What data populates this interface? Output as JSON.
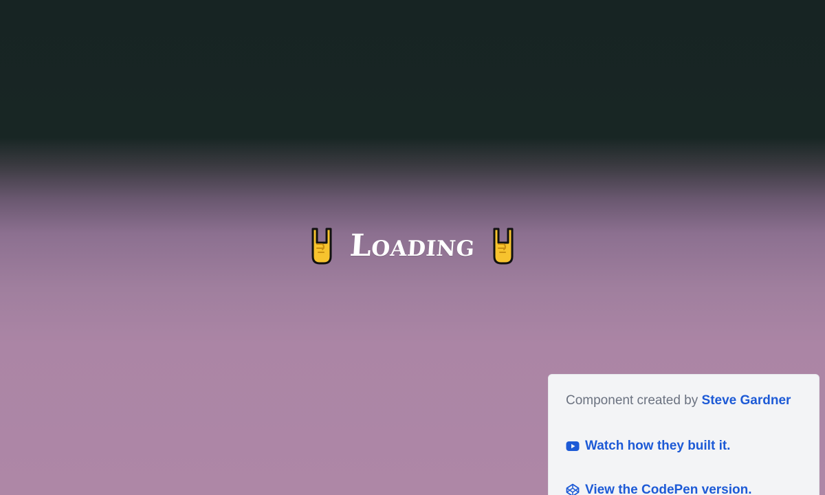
{
  "loader": {
    "text": "Loading",
    "left_icon": "sign-of-the-horns-icon",
    "right_icon": "sign-of-the-horns-icon"
  },
  "credit": {
    "prefix": "Component created by",
    "author": "Steve Gardner",
    "watch_link": {
      "label": "Watch how they built it.",
      "icon": "youtube-icon"
    },
    "codepen_link": {
      "label": "View the CodePen version.",
      "icon": "codepen-icon"
    }
  },
  "colors": {
    "link": "#1d5ad6",
    "muted_text": "#6b7280",
    "card_bg": "#f3f4f6",
    "top_bg": "#172423",
    "bottom_bg": "#ae87a6",
    "hand_fill": "#f7c32e"
  }
}
